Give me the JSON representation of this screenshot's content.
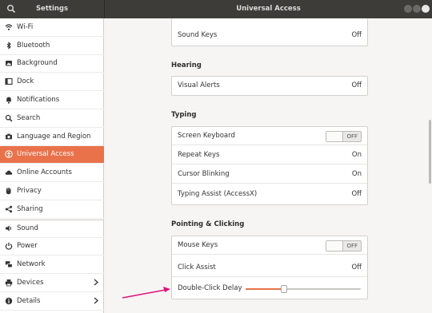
{
  "titlebar": {
    "left_title": "Settings",
    "right_title": "Universal Access"
  },
  "sidebar": {
    "items": [
      {
        "label": "Wi-Fi",
        "icon": "wifi-icon"
      },
      {
        "label": "Bluetooth",
        "icon": "bluetooth-icon"
      },
      {
        "label": "Background",
        "icon": "background-icon"
      },
      {
        "label": "Dock",
        "icon": "dock-icon"
      },
      {
        "label": "Notifications",
        "icon": "bell-icon"
      },
      {
        "label": "Search",
        "icon": "search-icon"
      },
      {
        "label": "Language and Region",
        "icon": "camera-icon"
      },
      {
        "label": "Universal Access",
        "icon": "accessibility-icon"
      },
      {
        "label": "Online Accounts",
        "icon": "cloud-icon"
      },
      {
        "label": "Privacy",
        "icon": "hand-icon"
      },
      {
        "label": "Sharing",
        "icon": "share-icon"
      },
      {
        "label": "Sound",
        "icon": "speaker-icon"
      },
      {
        "label": "Power",
        "icon": "power-icon"
      },
      {
        "label": "Network",
        "icon": "network-icon"
      },
      {
        "label": "Devices",
        "icon": "printer-icon"
      },
      {
        "label": "Details",
        "icon": "info-icon"
      }
    ],
    "active_index": 7
  },
  "main": {
    "top_card": {
      "label": "Sound Keys",
      "value": "Off"
    },
    "hearing": {
      "title": "Hearing",
      "rows": [
        {
          "label": "Visual Alerts",
          "value": "Off"
        }
      ]
    },
    "typing": {
      "title": "Typing",
      "rows": [
        {
          "label": "Screen Keyboard",
          "switch": "OFF"
        },
        {
          "label": "Repeat Keys",
          "value": "On"
        },
        {
          "label": "Cursor Blinking",
          "value": "On"
        },
        {
          "label": "Typing Assist (AccessX)",
          "value": "Off"
        }
      ]
    },
    "pointing": {
      "title": "Pointing & Clicking",
      "rows": [
        {
          "label": "Mouse Keys",
          "switch": "OFF"
        },
        {
          "label": "Click Assist",
          "value": "Off"
        },
        {
          "label": "Double-Click Delay",
          "slider_fraction": 0.33
        }
      ]
    }
  },
  "colors": {
    "accent": "#e9724a",
    "titlebar": "#3d3c38",
    "annotation_arrow": "#e0127b"
  }
}
